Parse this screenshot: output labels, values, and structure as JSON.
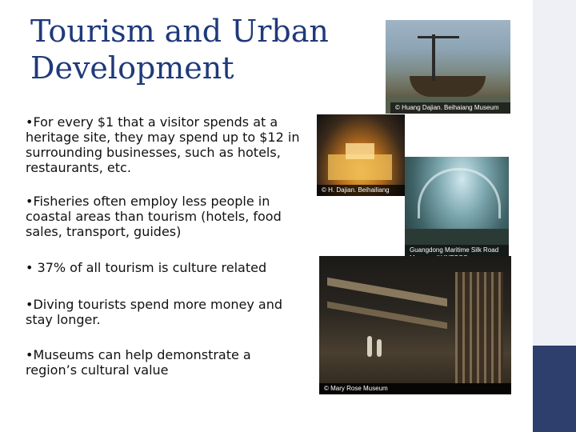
{
  "title": "Tourism and Urban Development",
  "bullets": [
    {
      "mark": "•",
      "text": "For every $1 that a visitor spends at a heritage site, they may spend up to $12 in surrounding businesses, such as hotels, restaurants, etc."
    },
    {
      "mark": "•",
      "text": "Fisheries often employ less people in coastal areas than tourism (hotels, food sales, transport, guides)"
    },
    {
      "mark": "•",
      "text": " 37% of all tourism is culture related"
    },
    {
      "mark": "•",
      "text": "Diving tourists spend more money and stay longer."
    },
    {
      "mark": "•",
      "text": "Museums can help demonstrate a region’s cultural value"
    }
  ],
  "photos": [
    {
      "caption": "© Huang Dajian. Beihaiang Museum"
    },
    {
      "caption": "© H. Dajian. Beihailiang"
    },
    {
      "caption": "Guangdong Maritime Silk Road Museum ©UNESCO"
    },
    {
      "caption": "© Mary Rose Museum"
    }
  ],
  "colors": {
    "title": "#1f3a7a",
    "side_bar": "#eef0f6",
    "side_block": "#2e3f6d"
  }
}
